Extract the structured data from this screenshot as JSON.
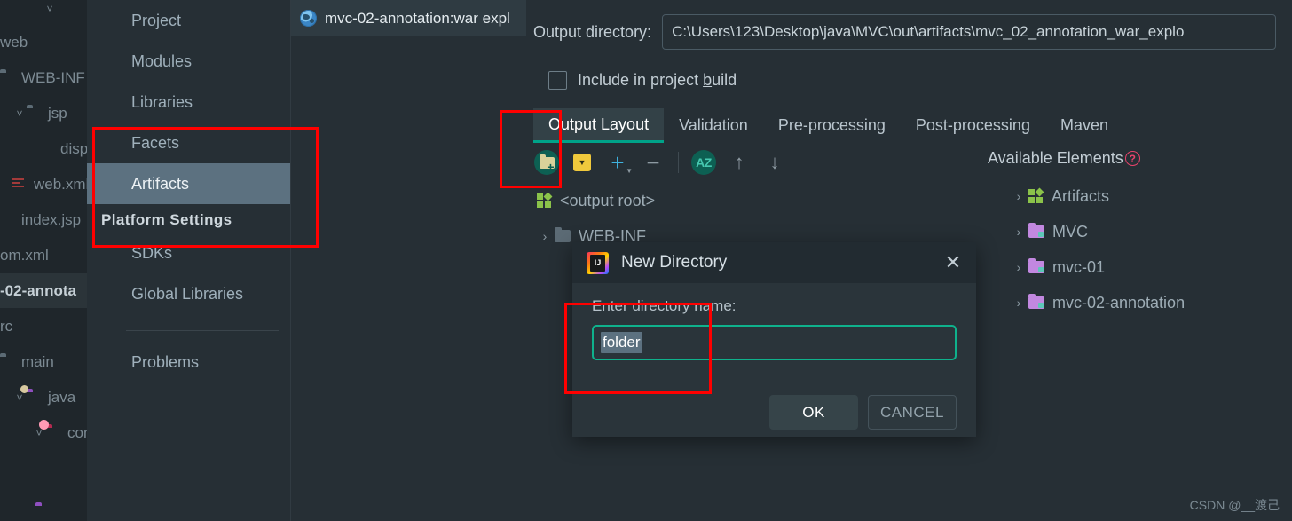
{
  "project_tree": {
    "rows": [
      {
        "label": "",
        "icon": "chevron-down-icon",
        "caret": "˅",
        "indent": 48
      },
      {
        "label": "web",
        "icon": "none",
        "caret": "",
        "indent": -8
      },
      {
        "label": "WEB-INF",
        "icon": "folder-gray-icon",
        "caret": "",
        "indent": -14
      },
      {
        "label": "jsp",
        "icon": "folder-gray-icon",
        "caret": "˅",
        "indent": 10
      },
      {
        "label": "disp",
        "icon": "jsp-file-icon",
        "caret": "",
        "indent": 36
      },
      {
        "label": "web.xml",
        "icon": "xml-file-icon",
        "caret": "",
        "indent": 8
      },
      {
        "label": "index.jsp",
        "icon": "jsp-file-icon",
        "caret": "",
        "indent": -10
      },
      {
        "label": "om.xml",
        "icon": "none",
        "caret": "",
        "indent": -10
      },
      {
        "label": "-02-annota",
        "icon": "none",
        "caret": "",
        "indent": -12,
        "selected": true
      },
      {
        "label": "rc",
        "icon": "none",
        "caret": "",
        "indent": -8
      },
      {
        "label": "main",
        "icon": "folder-gray-icon",
        "caret": "",
        "indent": -14
      },
      {
        "label": "java",
        "icon": "folder-java-icon",
        "caret": "˅",
        "indent": 10
      },
      {
        "label": "con",
        "icon": "folder-config-icon",
        "caret": "˅",
        "indent": 32
      },
      {
        "label": "",
        "icon": "cube-icon",
        "caret": "",
        "indent": 62
      },
      {
        "label": "",
        "icon": "folder-purple-icon",
        "caret": "",
        "indent": 38
      }
    ]
  },
  "settings_menu": {
    "items": [
      {
        "label": "Project",
        "type": "item"
      },
      {
        "label": "Modules",
        "type": "item"
      },
      {
        "label": "Libraries",
        "type": "item"
      },
      {
        "label": "Facets",
        "type": "item"
      },
      {
        "label": "Artifacts",
        "type": "item",
        "selected": true
      },
      {
        "label": "Platform Settings",
        "type": "group"
      },
      {
        "label": "SDKs",
        "type": "item"
      },
      {
        "label": "Global Libraries",
        "type": "item"
      },
      {
        "label": "Problems",
        "type": "item"
      }
    ]
  },
  "editor_tab": {
    "icon": "globe-icon",
    "label": "mvc-02-annotation:war expl"
  },
  "artifact_panel": {
    "output_directory_label": "Output directory:",
    "output_directory_value": "C:\\Users\\123\\Desktop\\java\\MVC\\out\\artifacts\\mvc_02_annotation_war_explo",
    "include_in_build_label_pre": "Include in project ",
    "include_in_build_label_accel": "b",
    "include_in_build_label_post": "uild",
    "include_in_build_checked": false,
    "tabs": [
      {
        "label": "Output Layout",
        "active": true
      },
      {
        "label": "Validation",
        "active": false
      },
      {
        "label": "Pre-processing",
        "active": false
      },
      {
        "label": "Post-processing",
        "active": false
      },
      {
        "label": "Maven",
        "active": false
      }
    ],
    "toolbar": [
      {
        "name": "create-directory-button",
        "icon": "folder-plus-icon"
      },
      {
        "name": "create-archive-button",
        "icon": "archive-icon"
      },
      {
        "name": "add-button",
        "icon": "plus-icon"
      },
      {
        "name": "remove-button",
        "icon": "minus-icon"
      },
      {
        "name": "sort-button",
        "icon": "sort-az-icon"
      },
      {
        "name": "move-up-button",
        "icon": "arrow-up-icon"
      },
      {
        "name": "move-down-button",
        "icon": "arrow-down-icon"
      }
    ],
    "output_tree": [
      {
        "label": "<output root>",
        "icon": "artifact-icon",
        "caret": "",
        "indent": 0
      },
      {
        "label": "WEB-INF",
        "icon": "folder-gray-icon",
        "caret": "›",
        "indent": 26
      }
    ],
    "available_elements_label": "Available Elements",
    "available_elements_help": "?",
    "available_elements": [
      {
        "label": "Artifacts",
        "icon": "artifact-icon",
        "caret": "›"
      },
      {
        "label": "MVC",
        "icon": "folder-module-icon",
        "caret": "›"
      },
      {
        "label": "mvc-01",
        "icon": "folder-module-icon",
        "caret": "›"
      },
      {
        "label": "mvc-02-annotation",
        "icon": "folder-module-icon",
        "caret": "›"
      }
    ]
  },
  "dialog": {
    "icon": "intellij-idea-icon",
    "title": "New Directory",
    "close_label": "✕",
    "prompt": "Enter directory name:",
    "input_value": "folder",
    "ok_label": "OK",
    "cancel_label": "CANCEL"
  },
  "annotations": {
    "box_color": "#ff0000",
    "boxes": [
      {
        "name": "menu-highlight"
      },
      {
        "name": "toolbar-highlight"
      },
      {
        "name": "input-highlight"
      }
    ]
  },
  "watermark": "CSDN @__渡己",
  "colors": {
    "background": "#262f35",
    "panel_dark": "#1f262b",
    "selection": "#5c7180",
    "accent_teal": "#00a389",
    "accent_blue": "#3fb3e0",
    "annotation_red": "#ff0000"
  }
}
